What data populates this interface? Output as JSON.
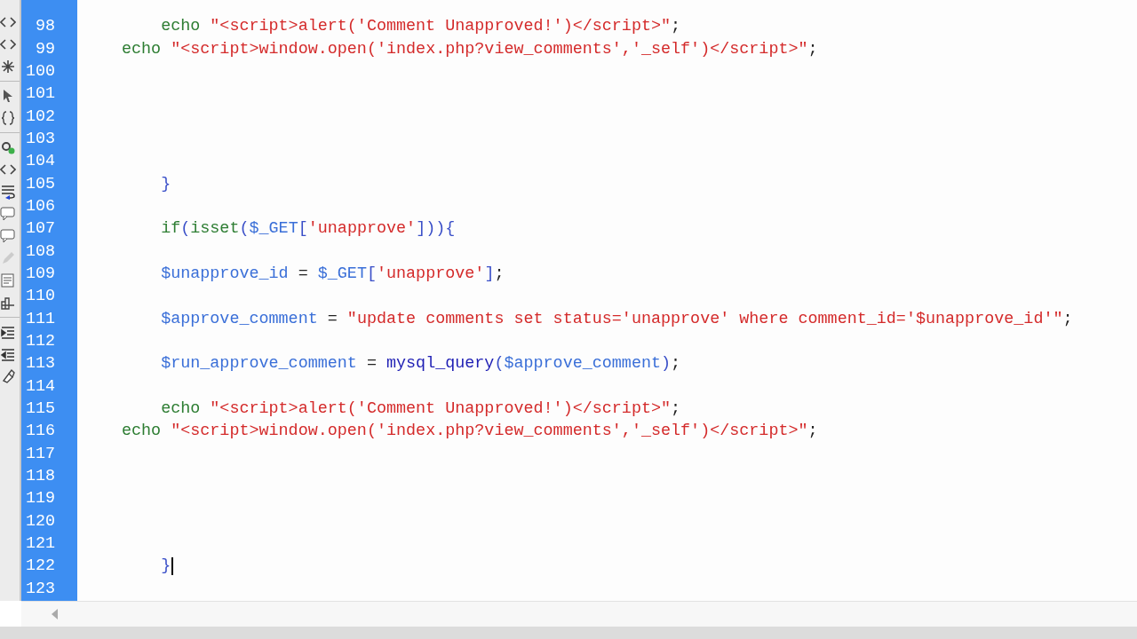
{
  "editor": {
    "lines": [
      {
        "number": "98",
        "tokens": [
          {
            "kind": "keyword",
            "text": "    echo "
          },
          {
            "kind": "string",
            "text": "\"<script>alert('Comment Unapproved!')</script>\""
          },
          {
            "kind": "plain",
            "text": ";"
          }
        ]
      },
      {
        "number": "99",
        "tokens": [
          {
            "kind": "keyword",
            "text": "echo "
          },
          {
            "kind": "string",
            "text": "\"<script>window.open('index.php?view_comments','_self')</script>\""
          },
          {
            "kind": "plain",
            "text": ";"
          }
        ]
      },
      {
        "number": "100"
      },
      {
        "number": "101"
      },
      {
        "number": "102"
      },
      {
        "number": "103"
      },
      {
        "number": "104"
      },
      {
        "number": "105",
        "tokens": [
          {
            "kind": "bracket",
            "text": "    }"
          }
        ]
      },
      {
        "number": "106"
      },
      {
        "number": "107",
        "tokens": [
          {
            "kind": "keyword",
            "text": "    if"
          },
          {
            "kind": "bracket",
            "text": "("
          },
          {
            "kind": "keyword",
            "text": "isset"
          },
          {
            "kind": "bracket",
            "text": "("
          },
          {
            "kind": "variable",
            "text": "$_GET"
          },
          {
            "kind": "bracket",
            "text": "["
          },
          {
            "kind": "string",
            "text": "'unapprove'"
          },
          {
            "kind": "bracket",
            "text": "])){"
          }
        ]
      },
      {
        "number": "108"
      },
      {
        "number": "109",
        "tokens": [
          {
            "kind": "variable",
            "text": "    $unapprove_id"
          },
          {
            "kind": "plain",
            "text": " = "
          },
          {
            "kind": "variable",
            "text": "$_GET"
          },
          {
            "kind": "bracket",
            "text": "["
          },
          {
            "kind": "string",
            "text": "'unapprove'"
          },
          {
            "kind": "bracket",
            "text": "]"
          },
          {
            "kind": "plain",
            "text": ";"
          }
        ]
      },
      {
        "number": "110"
      },
      {
        "number": "111",
        "tokens": [
          {
            "kind": "variable",
            "text": "    $approve_comment"
          },
          {
            "kind": "plain",
            "text": " = "
          },
          {
            "kind": "string",
            "text": "\"update comments set status='unapprove' where comment_id='$unapprove_id'\""
          },
          {
            "kind": "plain",
            "text": ";"
          }
        ]
      },
      {
        "number": "112"
      },
      {
        "number": "113",
        "tokens": [
          {
            "kind": "variable",
            "text": "    $run_approve_comment"
          },
          {
            "kind": "plain",
            "text": " = "
          },
          {
            "kind": "function",
            "text": "mysql_query"
          },
          {
            "kind": "bracket",
            "text": "("
          },
          {
            "kind": "variable",
            "text": "$approve_comment"
          },
          {
            "kind": "bracket",
            "text": ")"
          },
          {
            "kind": "plain",
            "text": ";"
          }
        ]
      },
      {
        "number": "114"
      },
      {
        "number": "115",
        "tokens": [
          {
            "kind": "keyword",
            "text": "    echo "
          },
          {
            "kind": "string",
            "text": "\"<script>alert('Comment Unapproved!')</script>\""
          },
          {
            "kind": "plain",
            "text": ";"
          }
        ]
      },
      {
        "number": "116",
        "tokens": [
          {
            "kind": "keyword",
            "text": "echo "
          },
          {
            "kind": "string",
            "text": "\"<script>window.open('index.php?view_comments','_self')</script>\""
          },
          {
            "kind": "plain",
            "text": ";"
          }
        ]
      },
      {
        "number": "117"
      },
      {
        "number": "118"
      },
      {
        "number": "119"
      },
      {
        "number": "120"
      },
      {
        "number": "121"
      },
      {
        "number": "122",
        "tokens": [
          {
            "kind": "bracket",
            "text": "    }"
          }
        ]
      },
      {
        "number": "123"
      }
    ]
  }
}
